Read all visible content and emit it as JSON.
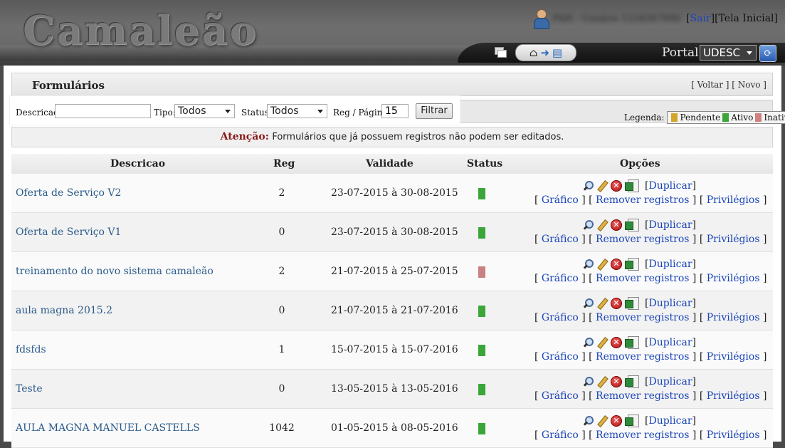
{
  "header": {
    "app_title": "Camaleão",
    "user_name": "PAH - Usuário 1234567890",
    "links": {
      "open": "[",
      "sair": "Sair",
      "mid": "][",
      "tela_inicial": "Tela Inicial",
      "close": "]"
    },
    "portal_label": "Portal:",
    "portal_value": "UDESC"
  },
  "page": {
    "title": "Formulários",
    "nav_links": "[ Voltar ] [ Novo ]"
  },
  "filter": {
    "descricao_label": "Descricao:",
    "descricao_value": "",
    "tipo_label": "Tipo:",
    "tipo_value": "Todos",
    "status_label": "Status:",
    "status_value": "Todos",
    "reg_label": "Reg / Página:",
    "reg_value": "15",
    "button": "Filtrar"
  },
  "legend": {
    "label": "Legenda:",
    "items": [
      {
        "label": "Pendente",
        "color": "#d4a52a"
      },
      {
        "label": "Ativo",
        "color": "#3aa63a"
      },
      {
        "label": "Inativo",
        "color": "#d08080"
      }
    ]
  },
  "notice": {
    "label": "Atenção:",
    "message": "Formulários que já possuem registros não podem ser editados."
  },
  "table": {
    "headers": {
      "descricao": "Descricao",
      "reg": "Reg",
      "validade": "Validade",
      "status": "Status",
      "opcoes": "Opções"
    },
    "action_labels": {
      "duplicar": "Duplicar",
      "grafico": "Gráfico",
      "remover": "Remover registros",
      "privilegios": "Privilégios"
    },
    "rows": [
      {
        "descricao": "Oferta de Serviço V2",
        "reg": "2",
        "validade": "23-07-2015 à 30-08-2015",
        "status_color": "#3aa63a"
      },
      {
        "descricao": "Oferta de Serviço V1",
        "reg": "0",
        "validade": "23-07-2015 à 30-08-2015",
        "status_color": "#3aa63a"
      },
      {
        "descricao": "treinamento do novo sistema camaleão",
        "reg": "2",
        "validade": "21-07-2015 à 25-07-2015",
        "status_color": "#c98080"
      },
      {
        "descricao": "aula magna 2015.2",
        "reg": "0",
        "validade": "21-07-2015 à 21-07-2016",
        "status_color": "#3aa63a"
      },
      {
        "descricao": "fdsfds",
        "reg": "1",
        "validade": "15-07-2015 à 15-07-2016",
        "status_color": "#3aa63a"
      },
      {
        "descricao": "Teste",
        "reg": "0",
        "validade": "13-05-2015 à 13-05-2016",
        "status_color": "#3aa63a"
      },
      {
        "descricao": "AULA MAGNA MANUEL CASTELLS",
        "reg": "1042",
        "validade": "01-05-2015 à 08-05-2016",
        "status_color": "#3aa63a"
      }
    ]
  }
}
